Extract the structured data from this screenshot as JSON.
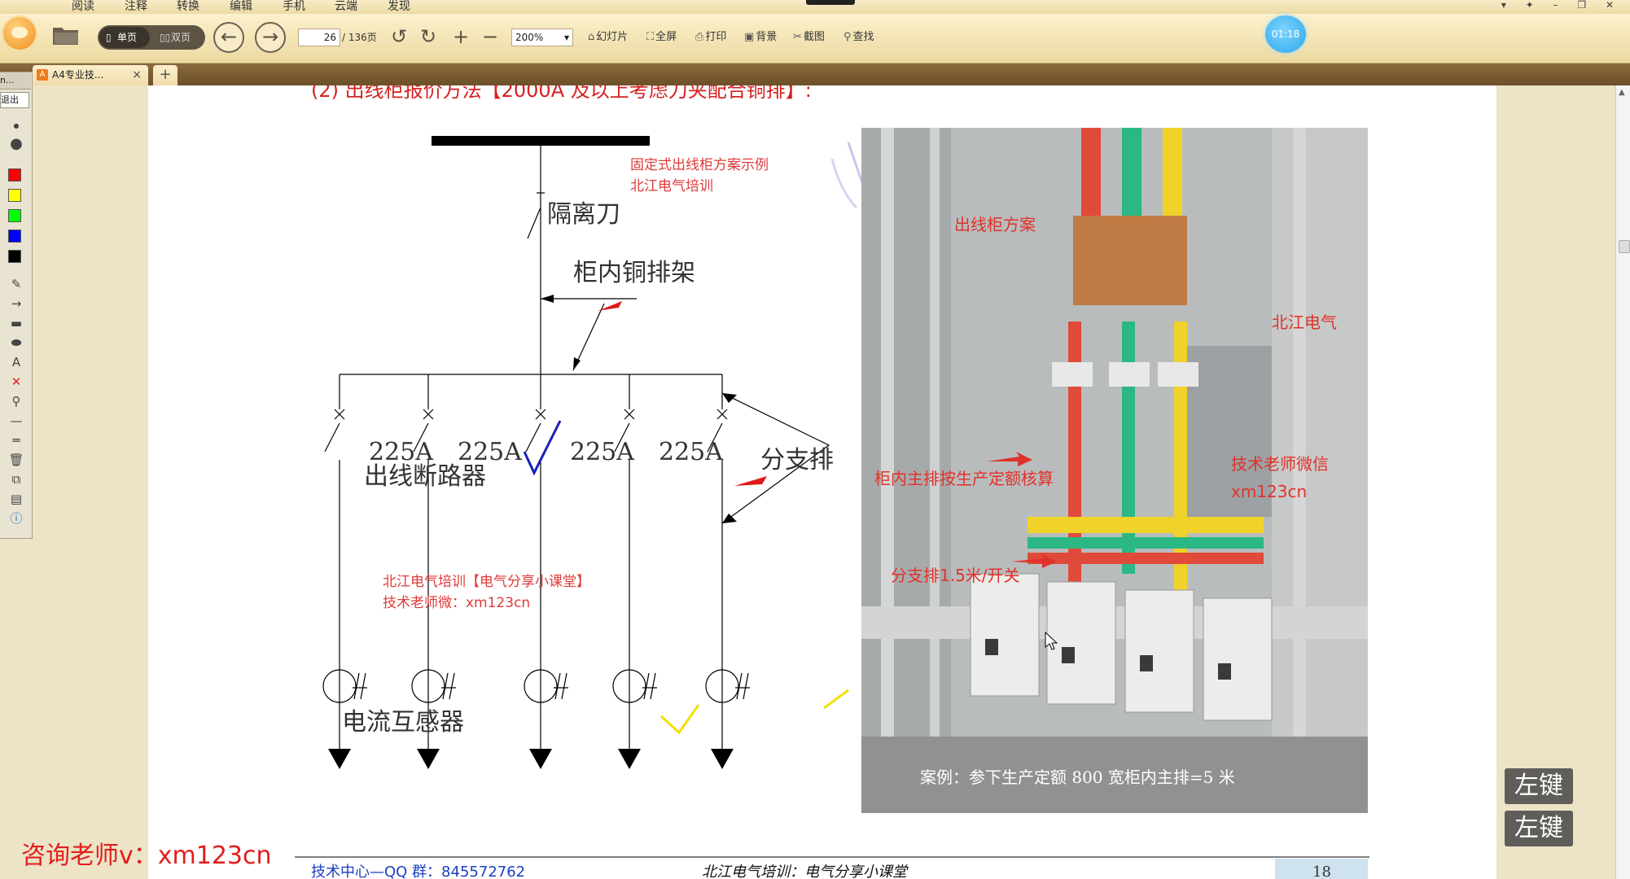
{
  "menu": {
    "items": [
      "阅读",
      "注释",
      "转换",
      "编辑",
      "手机",
      "云端",
      "发现"
    ]
  },
  "toolbar": {
    "single_page": "单页",
    "double_page": "双页",
    "page_current": "26",
    "page_total": "/ 136页",
    "zoom": "200%",
    "buttons": [
      "幻灯片",
      "全屏",
      "打印",
      "背景",
      "截图",
      "查找"
    ]
  },
  "timer": "01:18",
  "tab": {
    "title": "A4专业技...",
    "close": "×",
    "new": "+"
  },
  "palette": {
    "header": "n...",
    "exit": "退出",
    "colors": [
      "#ff0000",
      "#ffff00",
      "#00ff00",
      "#0000ff",
      "#000000"
    ]
  },
  "pdf": {
    "heading": "(2) 出线柜报价方法【2000A 及以上考虑刀夹配合铜排】:",
    "diagram": {
      "note_title": "固定式出线柜方案示例",
      "note_sub": "北江电气培训",
      "isolator": "隔离刀",
      "busbar_frame": "柜内铜排架",
      "breaker_rating": "225A",
      "breaker_label": "出线断路器",
      "branch_bar": "分支排",
      "training_line1": "北江电气培训【电气分享小课堂】",
      "training_line2": "技术老师微：xm123cn",
      "ct_label": "电流互感器"
    },
    "photo": {
      "label_scheme": "出线柜方案",
      "label_brand": "北江电气",
      "label_main_bar": "柜内主排按生产定额核算",
      "label_teacher": "技术老师微信",
      "label_wechat": "xm123cn",
      "label_branch": "分支排1.5米/开关",
      "caption": "案例：参下生产定额 800 宽柜内主排=5 米"
    },
    "footer": {
      "left": "技术中心—QQ 群：845572762",
      "center": "北江电气培训：电气分享小课堂",
      "page": "18"
    }
  },
  "overlay": {
    "consult": "咨询老师v：xm123cn",
    "key_badge_1": "左键",
    "key_badge_2": "左键"
  }
}
